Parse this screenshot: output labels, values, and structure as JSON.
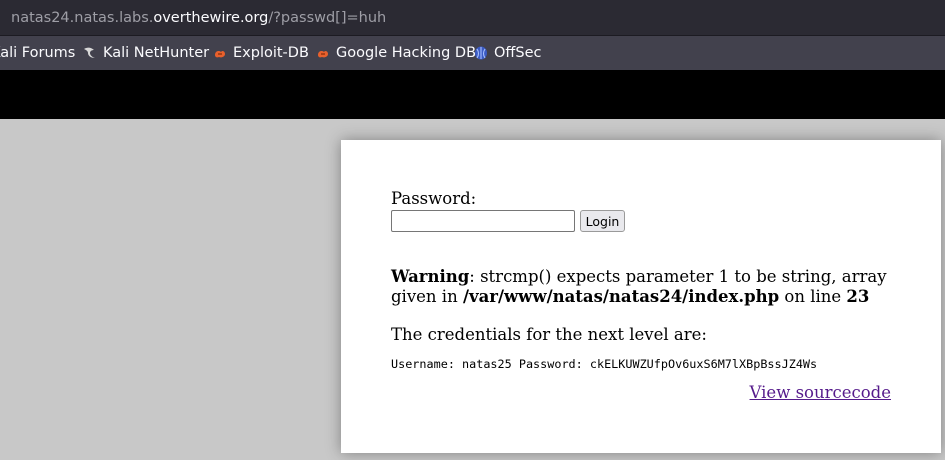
{
  "browser": {
    "url_prefix": "natas24.natas.labs.",
    "url_domain": "overthewire.org",
    "url_suffix": "/?passwd[]=huh"
  },
  "bookmarks": [
    {
      "label": "Kali Forums",
      "icon": "kali-forums-icon"
    },
    {
      "label": "Kali NetHunter",
      "icon": "kali-dragon-icon"
    },
    {
      "label": "Exploit-DB",
      "icon": "exploit-db-icon"
    },
    {
      "label": "Google Hacking DB",
      "icon": "ghdb-icon"
    },
    {
      "label": "OffSec",
      "icon": "offsec-icon"
    }
  ],
  "page": {
    "password_label": "Password:",
    "password_value": "",
    "login_label": "Login",
    "warning": {
      "label": "Warning",
      "text1": ": strcmp() expects parameter 1 to be string, array given in ",
      "path": "/var/www/natas/natas24/index.php",
      "text2": " on line ",
      "line": "23"
    },
    "creds_intro": "The credentials for the next level are:",
    "creds": "Username: natas25 Password: ckELKUWZUfpOv6uxS6M7lXBpBssJZ4Ws",
    "source_link": "View sourcecode"
  },
  "colors": {
    "urlbar_bg": "#2b2a33",
    "bookmarks_bg": "#42414d",
    "page_bg": "#c8c8c8",
    "link_visited": "#551a8b",
    "exploit_icon": "#e8602c",
    "offsec_icon": "#5a7bd8"
  }
}
